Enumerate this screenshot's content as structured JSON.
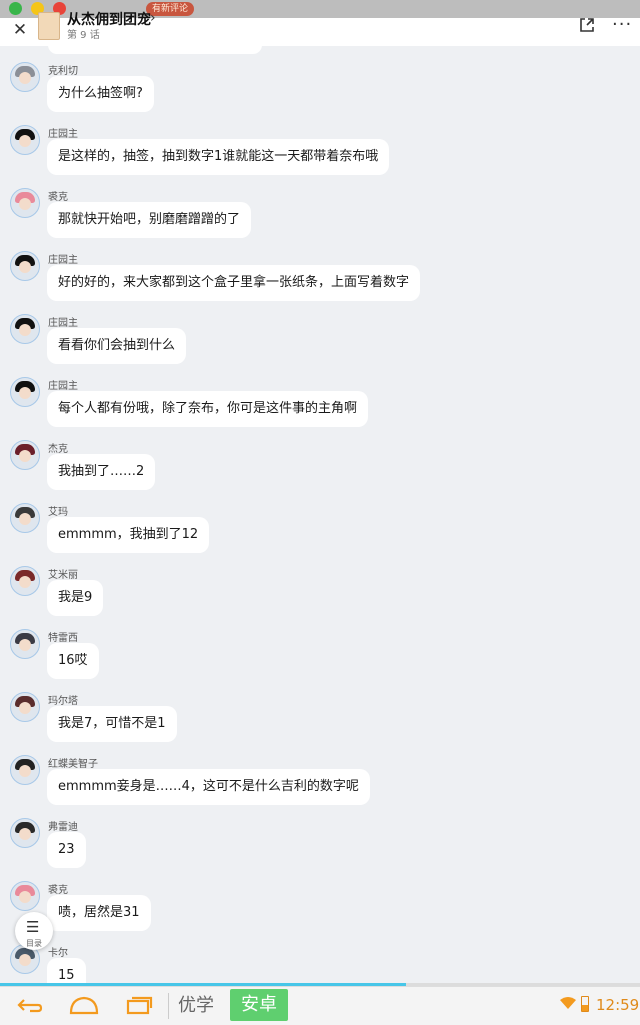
{
  "status_strip": {
    "badge": "有新评论"
  },
  "header": {
    "title": "从杰佣到团宠",
    "episode": "第 9 话",
    "close_icon": "close-icon",
    "share_icon": "share-icon",
    "more_icon": "more-icon"
  },
  "messages": [
    {
      "sender": "克利切",
      "text": "为什么抽签啊?",
      "avatar_color": "#8b8f97"
    },
    {
      "sender": "庄园主",
      "text": "是这样的，抽签，抽到数字1谁就能这一天都带着奈布哦",
      "avatar_color": "#111111"
    },
    {
      "sender": "裘克",
      "text": "那就快开始吧，别磨磨蹭蹭的了",
      "avatar_color": "#e98a9a"
    },
    {
      "sender": "庄园主",
      "text": "好的好的，来大家都到这个盒子里拿一张纸条，上面写着数字",
      "avatar_color": "#111111"
    },
    {
      "sender": "庄园主",
      "text": "看看你们会抽到什么",
      "avatar_color": "#111111"
    },
    {
      "sender": "庄园主",
      "text": "每个人都有份哦，除了奈布，你可是这件事的主角啊",
      "avatar_color": "#111111"
    },
    {
      "sender": "杰克",
      "text": "我抽到了……2",
      "avatar_color": "#6b1f2a"
    },
    {
      "sender": "艾玛",
      "text": "emmmm，我抽到了12",
      "avatar_color": "#3a3a3a"
    },
    {
      "sender": "艾米丽",
      "text": "我是9",
      "avatar_color": "#7a2a2a"
    },
    {
      "sender": "特雷西",
      "text": "16哎",
      "avatar_color": "#3b3b45"
    },
    {
      "sender": "玛尔塔",
      "text": "我是7，可惜不是1",
      "avatar_color": "#5a2d2d"
    },
    {
      "sender": "红蝶美智子",
      "text": "emmmm妾身是……4，这可不是什么吉利的数字呢",
      "avatar_color": "#222222"
    },
    {
      "sender": "弗雷迪",
      "text": "23",
      "avatar_color": "#2a2a2a"
    },
    {
      "sender": "裘克",
      "text": "啧，居然是31",
      "avatar_color": "#e98a9a"
    },
    {
      "sender": "卡尔",
      "text": "15",
      "avatar_color": "#4a5a6a"
    }
  ],
  "directory_button": {
    "label": "目录",
    "icon": "list-icon"
  },
  "read_progress": 0.635,
  "navbar": {
    "brand_left": "优学",
    "brand_right": "安卓",
    "time": "12:59",
    "battery_level": 0.4,
    "back_icon": "back-icon",
    "home_icon": "home-icon",
    "recent_icon": "recent-apps-icon"
  }
}
